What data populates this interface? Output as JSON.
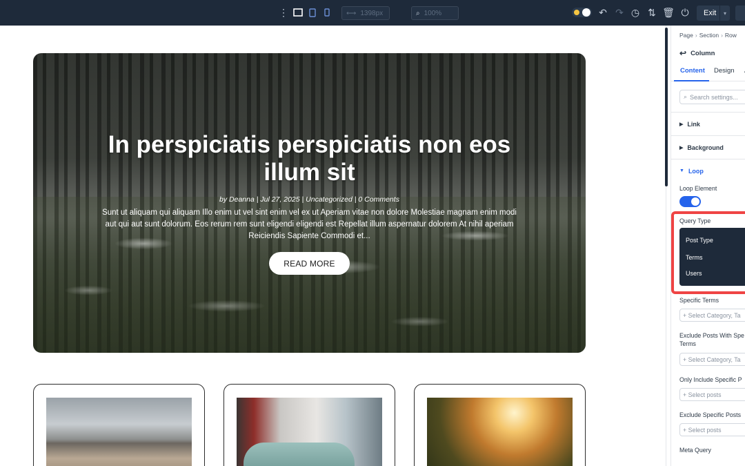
{
  "toolbar": {
    "width_value": "1398px",
    "zoom_value": "100%",
    "exit_label": "Exit"
  },
  "hero": {
    "title": "In perspiciatis perspiciatis non eos illum sit",
    "meta": "by Deanna | Jul 27, 2025 | Uncategorized | 0 Comments",
    "excerpt": "Sunt ut aliquam qui aliquam Illo enim ut vel sint enim vel ex ut Aperiam vitae non dolore Molestiae magnam enim modi aut qui aut sunt dolorum. Eos rerum rem sunt eligendi eligendi est Repellat illum aspernatur dolorem At nihil aperiam Reiciendis Sapiente Commodi et...",
    "button_label": "READ MORE"
  },
  "panel": {
    "breadcrumb": [
      "Page",
      "Section",
      "Row"
    ],
    "title": "Column",
    "tabs": [
      "Content",
      "Design",
      "A"
    ],
    "search_placeholder": "Search settings...",
    "sections": {
      "link": "Link",
      "background": "Background",
      "loop": "Loop"
    },
    "loop_element_label": "Loop Element",
    "loop_element_on": true,
    "query_type_label": "Query Type",
    "query_type_options": [
      "Post Type",
      "Terms",
      "Users"
    ],
    "specific_terms_label": "Specific Terms",
    "specific_terms_placeholder": "+ Select Category, Ta",
    "exclude_terms_label_1": "Exclude Posts With Spe",
    "exclude_terms_label_2": "Terms",
    "exclude_terms_placeholder": "+ Select Category, Ta",
    "only_include_label": "Only Include Specific P",
    "only_include_placeholder": "+ Select posts",
    "exclude_specific_label": "Exclude Specific Posts",
    "exclude_specific_placeholder": "+ Select posts",
    "meta_query_label": "Meta Query"
  }
}
